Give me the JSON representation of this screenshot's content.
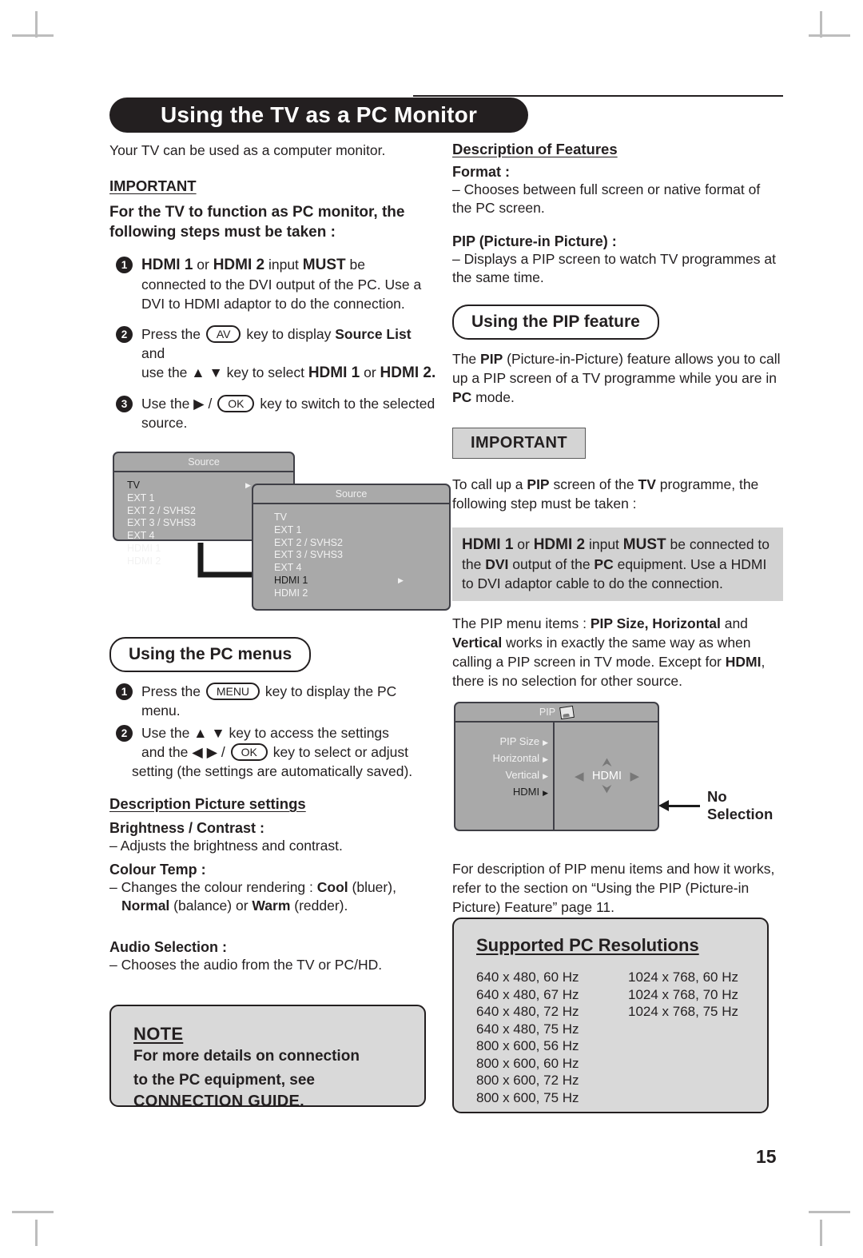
{
  "page": {
    "title": "Using the TV as a PC Monitor",
    "number": "15"
  },
  "left": {
    "intro": "Your TV can be used as a computer monitor.",
    "important_label": "IMPORTANT",
    "important_body": "For the TV to function as PC monitor, the following steps must be taken :",
    "steps": [
      {
        "num": "1",
        "line1_a": "HDMI 1",
        "line1_b": " or ",
        "line1_c": "HDMI 2",
        "line1_d": " input ",
        "line1_e": "MUST",
        "line1_f": " be",
        "rest": "connected to the DVI output of the PC. Use a DVI to HDMI adaptor to do the connection."
      },
      {
        "num": "2",
        "pre": "Press the",
        "key": "AV",
        "mid": "key to display",
        "bold1": "Source List",
        "and": "and",
        "line2_pre": "use the",
        "arrows": "▲ ▼",
        "line2_mid": "key to select",
        "bold2": "HDMI 1",
        "or": "or",
        "bold3": "HDMI 2."
      },
      {
        "num": "3",
        "pre": "Use the ▶ /",
        "key": "OK",
        "post": "key to switch to the selected source."
      }
    ],
    "source_menu_1": {
      "title": "Source",
      "items": [
        "TV",
        "EXT 1",
        "EXT 2 / SVHS2",
        "EXT 3 / SVHS3",
        "EXT 4",
        "HDMI 1",
        "HDMI 2"
      ],
      "selected": "TV"
    },
    "source_menu_2": {
      "title": "Source",
      "items": [
        "TV",
        "EXT 1",
        "EXT 2 / SVHS2",
        "EXT 3 / SVHS3",
        "EXT 4",
        "HDMI 1",
        "HDMI 2"
      ],
      "selected": "HDMI 1"
    },
    "pc_menus_heading": "Using the PC menus",
    "pc_steps": [
      {
        "num": "1",
        "pre": "Press the",
        "key": "MENU",
        "post": "key to display the PC menu."
      },
      {
        "num": "2",
        "line1": "Use the ▲ ▼ key to access the settings",
        "line2_pre": "and the ◀ ▶ /",
        "key": "OK",
        "line2_post": "key to select or adjust",
        "line3": "setting (the settings are automatically saved)."
      }
    ],
    "picture_settings_heading": "Description Picture settings",
    "settings": [
      {
        "label": "Brightness / Contrast :",
        "desc": "– Adjusts the brightness and contrast."
      },
      {
        "label": "Colour Temp :",
        "desc_line1_pre": "– Changes the colour rendering : ",
        "desc_bold1": "Cool",
        "desc_line1_post": " (bluer),",
        "desc_bold2": "Normal",
        "desc_line2_mid": " (balance) or ",
        "desc_bold3": "Warm",
        "desc_line2_post": " (redder)."
      },
      {
        "label": "Audio Selection :",
        "desc": "– Chooses the audio from the TV or PC/HD."
      }
    ],
    "note": {
      "heading": "NOTE",
      "line1": "For more details on connection",
      "line2_pre": "to the ",
      "line2_bold": "PC",
      "line2_post": " equipment, see",
      "line3": "CONNECTION GUIDE."
    }
  },
  "right": {
    "features_heading": "Description of Features",
    "format_label": "Format :",
    "format_desc": "– Chooses between full screen or native format of the PC screen.",
    "pip_label": "PIP (Picture-in Picture) :",
    "pip_desc": "– Displays a PIP screen to watch TV programmes at the same time.",
    "pip_feature_heading": "Using the PIP feature",
    "pip_feature_body_pre": "The ",
    "pip_feature_body_b1": "PIP",
    "pip_feature_body_mid": " (Picture-in-Picture) feature allows you to call up a PIP screen of a TV programme while you are in ",
    "pip_feature_body_b2": "PC",
    "pip_feature_body_post": " mode.",
    "important_label": "IMPORTANT",
    "important_intro_pre": "To call up a ",
    "important_intro_b1": "PIP",
    "important_intro_mid": " screen of the ",
    "important_intro_b2": "TV",
    "important_intro_post": " programme, the following step must be taken :",
    "gray_block": {
      "b1": "HDMI 1",
      "t1": " or ",
      "b2": "HDMI 2",
      "t2": " input ",
      "b3": "MUST",
      "t3": " be connected to the ",
      "b4": "DVI",
      "t4": " output of the ",
      "b5": "PC",
      "t5": " equipment. Use a HDMI to DVI adaptor cable to do the connection."
    },
    "menu_items_para": {
      "t1": "The PIP menu items : ",
      "b1": "PIP Size, Horizontal",
      "t2": " and ",
      "b2": "Vertical",
      "t3": " works in exactly the same way as when calling a PIP screen in TV mode. Except for ",
      "b3": "HDMI",
      "t4": ", there is no selection for other source."
    },
    "pip_menu": {
      "title": "PIP",
      "items": [
        "PIP Size",
        "Horizontal",
        "Vertical",
        "HDMI"
      ],
      "value": "HDMI",
      "annotation": "No Selection"
    },
    "refer_para": "For description of PIP menu items and how it works, refer to the section on “Using the  PIP (Picture-in Picture) Feature” page 11.",
    "resolutions": {
      "heading": "Supported PC Resolutions",
      "col1": [
        "640 x 480, 60 Hz",
        "640 x 480, 67 Hz",
        "640 x 480, 72 Hz",
        "640 x 480, 75 Hz",
        "800 x 600, 56 Hz",
        "800 x 600, 60 Hz",
        "800 x 600, 72 Hz",
        "800 x 600, 75 Hz"
      ],
      "col2": [
        "1024 x 768, 60 Hz",
        "1024 x 768, 70 Hz",
        "1024 x 768, 75 Hz"
      ]
    }
  }
}
